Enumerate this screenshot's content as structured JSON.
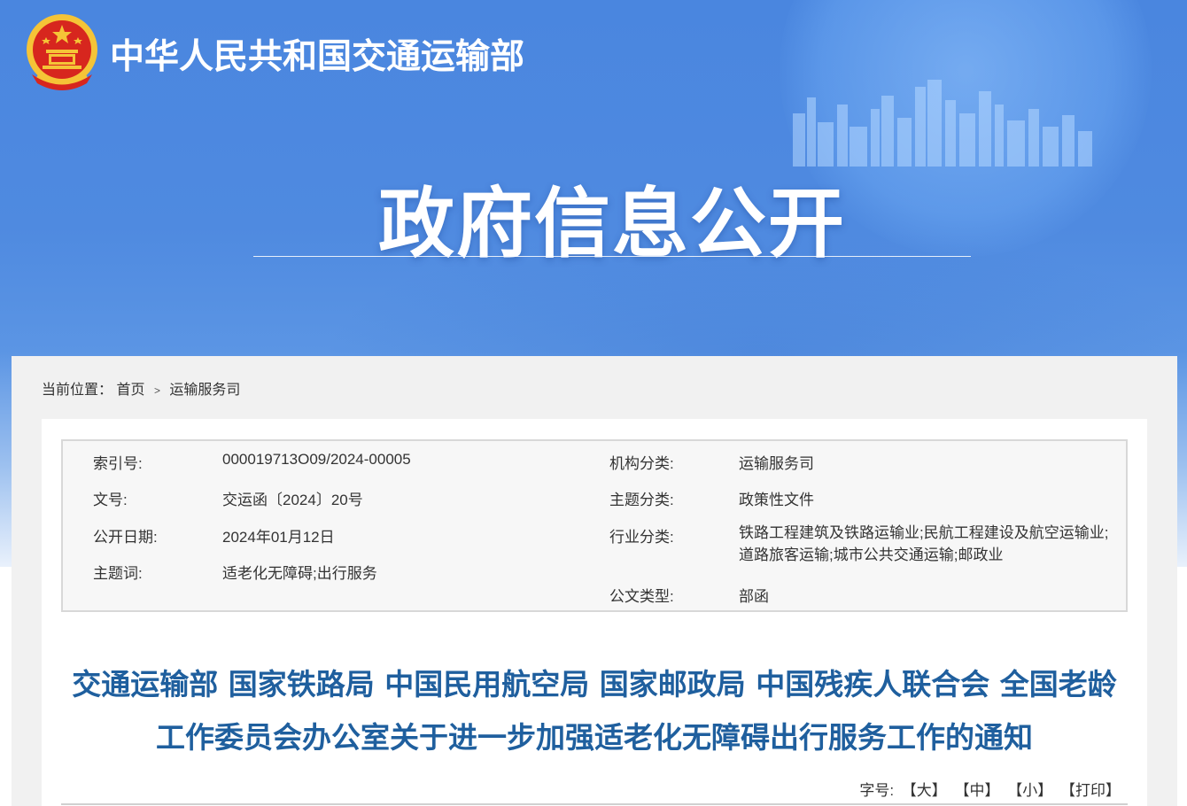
{
  "header": {
    "site_title": "中华人民共和国交通运输部",
    "section_title": "政府信息公开",
    "emblem_icon": "national-emblem-icon"
  },
  "breadcrumb": {
    "label": "当前位置：",
    "items": [
      "首页",
      "运输服务司"
    ],
    "separator": ">"
  },
  "meta": {
    "index_label": "索引号:",
    "index_value": "000019713O09/2024-00005",
    "doc_no_label": "文号:",
    "doc_no_value": "交运函〔2024〕20号",
    "date_label": "公开日期:",
    "date_value": "2024年01月12日",
    "keywords_label": "主题词:",
    "keywords_value": "适老化无障碍;出行服务",
    "org_label": "机构分类:",
    "org_value": "运输服务司",
    "topic_label": "主题分类:",
    "topic_value": "政策性文件",
    "industry_label": "行业分类:",
    "industry_value": "铁路工程建筑及铁路运输业;民航工程建设及航空运输业;道路旅客运输;城市公共交通运输;邮政业",
    "doctype_label": "公文类型:",
    "doctype_value": "部函"
  },
  "document": {
    "title": "交通运输部 国家铁路局 中国民用航空局 国家邮政局 中国残疾人联合会 全国老龄工作委员会办公室关于进一步加强适老化无障碍出行服务工作的通知"
  },
  "font_size": {
    "label": "字号:",
    "large": "【大】",
    "medium": "【中】",
    "small": "【小】",
    "print": "【打印】"
  },
  "colors": {
    "banner_blue": "#4a86df",
    "title_blue": "#1f5f9e",
    "emblem_red": "#d7261e",
    "emblem_gold": "#f5c437"
  }
}
